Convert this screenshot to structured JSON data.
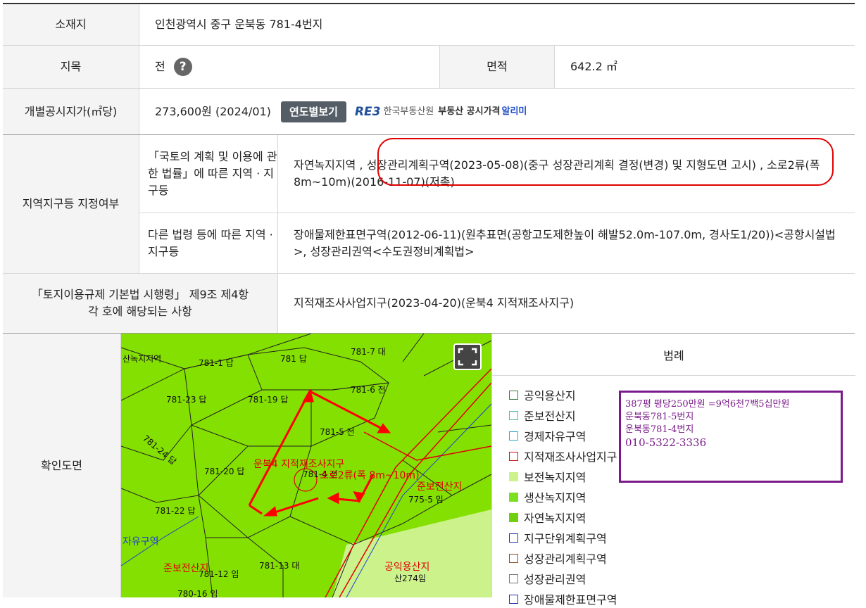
{
  "rows": {
    "location": {
      "label": "소재지",
      "value": "인천광역시 중구 운북동 781-4번지"
    },
    "jimok": {
      "label": "지목",
      "value": "전",
      "help_icon": "?",
      "area_label": "면적",
      "area_value": "642.2 ㎡"
    },
    "price": {
      "label": "개별공시지가(㎡당)",
      "value": "273,600원 (2024/01)",
      "button": "연도별보기",
      "reb_logo": "RE3",
      "reb_name": "한국부동산원",
      "reb_service": "부동산 공시가격",
      "reb_service2": "알리미"
    },
    "zoning": {
      "label": "지역지구등 지정여부",
      "law1_label": "「국토의 계획 및 이용에 관한 법률」에 따른 지역 · 지구등",
      "law1_value": "자연녹지지역 , 성장관리계획구역(2023-05-08)(중구 성장관리계획 결정(변경) 및 지형도면 고시) , 소로2류(폭 8m~10m)(2016-11-07)(저촉)",
      "law2_label": "다른 법령 등에 따른 지역 · 지구등",
      "law2_value": "장애물제한표면구역(2012-06-11)(원추표면(공항고도제한높이 해발52.0m-107.0m, 경사도1/20))<공항시설법>, 성장관리권역<수도권정비계획법>"
    },
    "enforcement": {
      "label": "「토지이용규제 기본법 시행령」 제9조 제4항 각 호에 해당되는 사항",
      "value": "지적재조사사업지구(2023-04-20)(운북4 지적재조사지구)"
    },
    "map_row": {
      "label": "확인도면"
    }
  },
  "map": {
    "parcels": [
      "781-1 답",
      "781 답",
      "781-7 대",
      "781-6 전",
      "781-23 답",
      "781-19 답",
      "781-5 전",
      "781-24 답",
      "781-20 답",
      "781-4 전",
      "781-22 답",
      "775-5 임",
      "781-13 대",
      "781-12 임",
      "780-16 임",
      "산274임"
    ],
    "zone_labels": [
      "운북4 지적재조사지구",
      "소로2류(폭 8m~10m)",
      "준보전산지",
      "공익용산지",
      "산녹지지역",
      "자유구역"
    ],
    "colors": {
      "green": "#84e000",
      "light_green": "#ccf28c",
      "red": "#e00000",
      "parcel_line": "#222222",
      "blue": "#2040d0"
    }
  },
  "legend": {
    "title": "범례",
    "items": [
      {
        "label": "공익용산지",
        "color": "#3a7a3a"
      },
      {
        "label": "준보전산지",
        "color": "#4fb8a8"
      },
      {
        "label": "경제자유구역",
        "color": "#28a8c8"
      },
      {
        "label": "지적재조사사업지구",
        "color": "#d01010"
      },
      {
        "label": "보전녹지지역",
        "color": "#ccf28c",
        "fill": true
      },
      {
        "label": "생산녹지지역",
        "color": "#7ce020",
        "fill": true
      },
      {
        "label": "자연녹지지역",
        "color": "#70d010",
        "fill": true
      },
      {
        "label": "지구단위계획구역",
        "color": "#2030b0"
      },
      {
        "label": "성장관리계획구역",
        "color": "#8a4a20"
      },
      {
        "label": "성장관리권역",
        "color": "#777777"
      },
      {
        "label": "장애물제한표면구역",
        "color": "#2030b0"
      }
    ]
  },
  "note": {
    "line1": "387평   평당250만원   =9억6천7백5십만원",
    "line2": "운북동781-5번지",
    "line3": "운북동781-4번지",
    "line4": "010-5322-3336"
  }
}
